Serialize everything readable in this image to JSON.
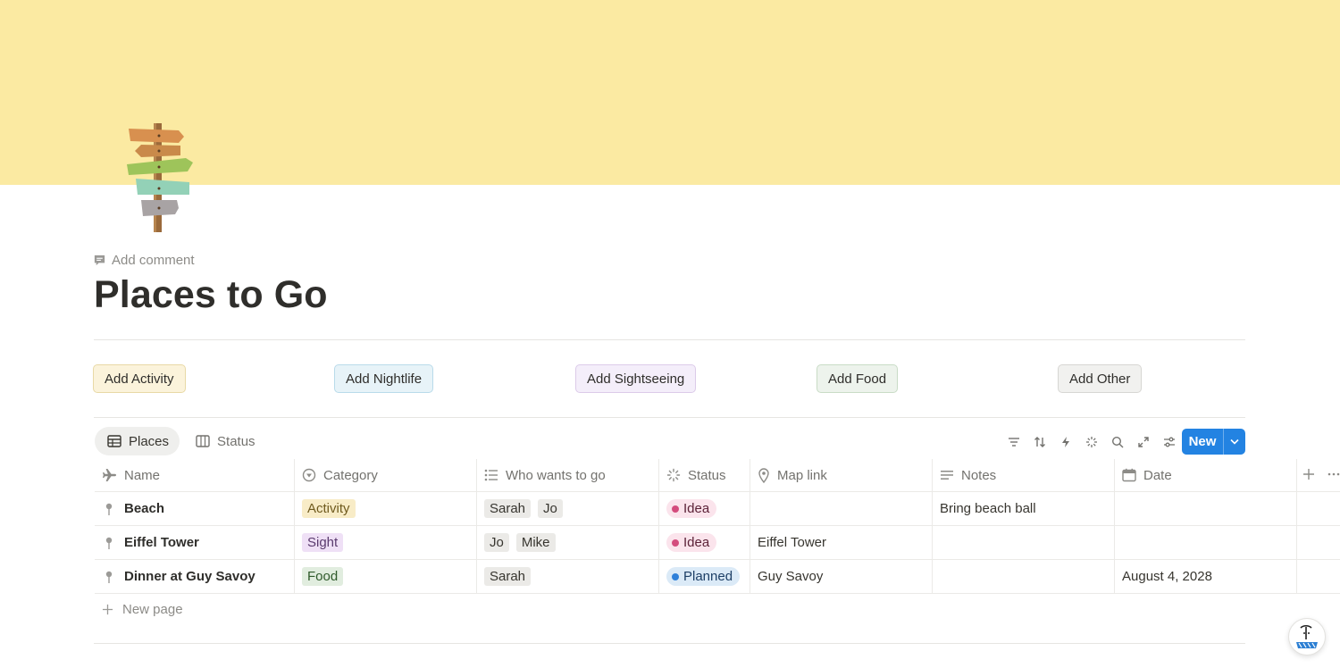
{
  "page": {
    "title": "Places to Go",
    "add_comment": "Add comment"
  },
  "buttons": [
    {
      "label": "Add Activity",
      "bg": "#fbf3db",
      "border": "#e8d9a6"
    },
    {
      "label": "Add Nightlife",
      "bg": "#e7f3f8",
      "border": "#b9dbea"
    },
    {
      "label": "Add Sightseeing",
      "bg": "#f4eefa",
      "border": "#dccbe9"
    },
    {
      "label": "Add Food",
      "bg": "#edf3ec",
      "border": "#c9dcc6"
    },
    {
      "label": "Add Other",
      "bg": "#f1f1ef",
      "border": "#d7d6d3"
    }
  ],
  "views": {
    "places": "Places",
    "status": "Status"
  },
  "toolbar": {
    "new_label": "New",
    "icons": [
      "filter-icon",
      "sort-icon",
      "automation-icon",
      "ai-autofill-icon",
      "search-icon",
      "expand-icon",
      "settings-icon"
    ]
  },
  "columns": {
    "name": "Name",
    "category": "Category",
    "who": "Who wants to go",
    "status": "Status",
    "map": "Map link",
    "notes": "Notes",
    "date": "Date"
  },
  "rows": [
    {
      "name": "Beach",
      "category": "Activity",
      "who": [
        "Sarah",
        "Jo"
      ],
      "status": "Idea",
      "map": "",
      "notes": "Bring beach ball",
      "date": ""
    },
    {
      "name": "Eiffel Tower",
      "category": "Sight",
      "who": [
        "Jo",
        "Mike"
      ],
      "status": "Idea",
      "map": "Eiffel Tower",
      "notes": "",
      "date": ""
    },
    {
      "name": "Dinner at Guy Savoy",
      "category": "Food",
      "who": [
        "Sarah"
      ],
      "status": "Planned",
      "map": "Guy Savoy",
      "notes": "",
      "date": "August 4, 2028"
    }
  ],
  "new_page": "New page",
  "colors": {
    "cover": "#fbeaa2",
    "accent": "#2383e2",
    "activity_tag": "#f8ecc7",
    "sight_tag": "#efe0f6",
    "food_tag": "#e1eddf",
    "person_tag": "#ebeae7",
    "idea_pill": "#fbe4ec",
    "idea_dot": "#d44c7d",
    "planned_pill": "#dbeaf7",
    "planned_dot": "#2f80d9"
  }
}
